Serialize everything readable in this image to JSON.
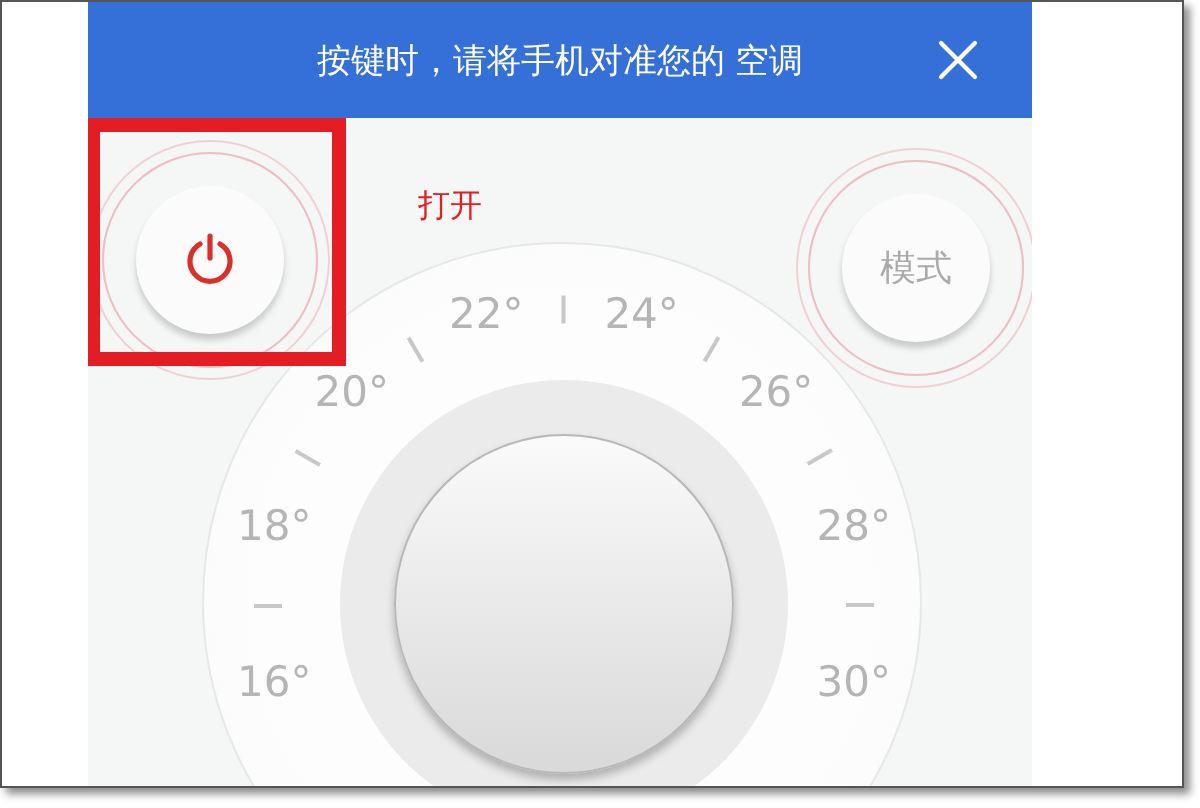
{
  "header": {
    "title": "按键时，请将手机对准您的 空调"
  },
  "power": {
    "label": "打开"
  },
  "mode_button": {
    "label": "模式"
  },
  "dial": {
    "labels": [
      "16°",
      "18°",
      "20°",
      "22°",
      "24°",
      "26°",
      "28°",
      "30°"
    ]
  },
  "annotation": {
    "kind": "frame"
  }
}
